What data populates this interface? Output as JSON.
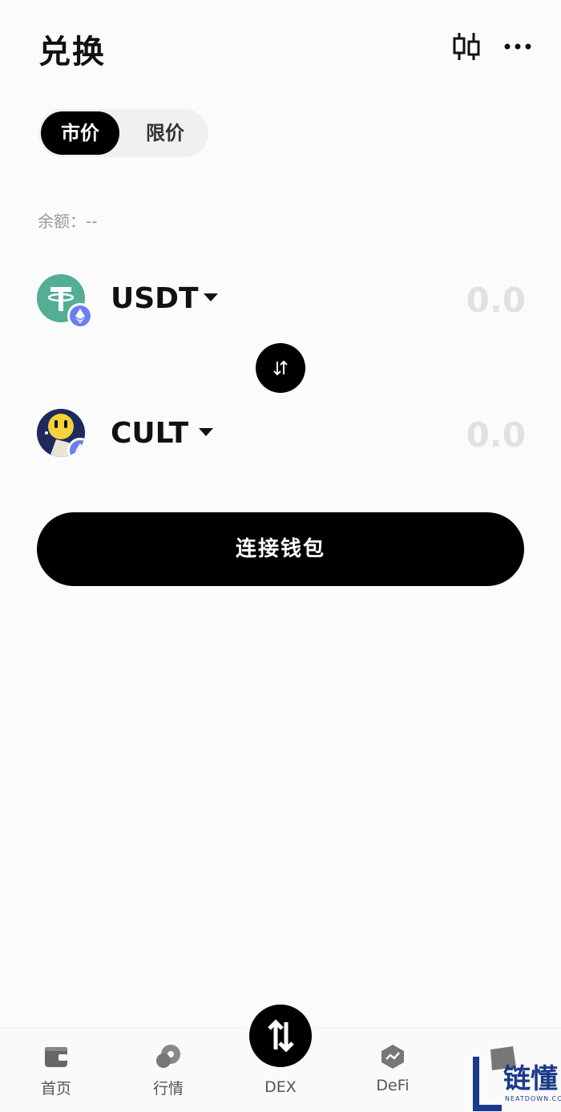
{
  "header": {
    "title": "兑换",
    "icons": [
      "candlestick-icon",
      "more-icon"
    ]
  },
  "order_type": {
    "tabs": [
      {
        "label": "市价",
        "selected": true
      },
      {
        "label": "限价",
        "selected": false
      }
    ]
  },
  "balance": {
    "label": "余额：--"
  },
  "from_token": {
    "symbol": "USDT",
    "amount_placeholder": "0.0",
    "chain_badge": "ethereum-icon"
  },
  "to_token": {
    "symbol": "CULT",
    "amount_placeholder": "0.0",
    "chain_badge": "ethereum-icon"
  },
  "action": {
    "connect_label": "连接钱包"
  },
  "tabbar": {
    "items": [
      {
        "label": "首页",
        "icon": "wallet-icon"
      },
      {
        "label": "行情",
        "icon": "market-icon"
      },
      {
        "label": "DEX",
        "icon": "swap-icon"
      },
      {
        "label": "DeFi",
        "icon": "defi-icon"
      }
    ]
  },
  "watermark": {
    "text": "链懂",
    "sub": "NEATDOWN.COM"
  },
  "colors": {
    "accent": "#000000",
    "usdt": "#53ae94",
    "eth_badge": "#6c7ff0",
    "amount_placeholder": "#e1e1e1"
  }
}
